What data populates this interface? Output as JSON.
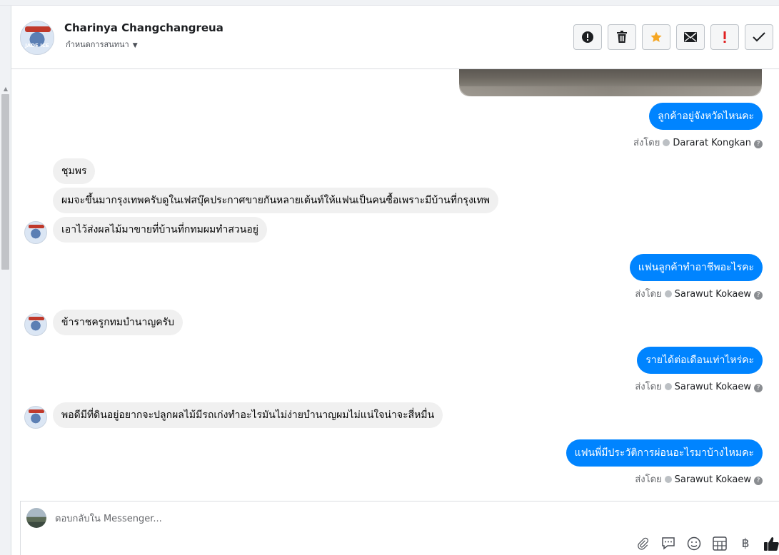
{
  "header": {
    "contact_name": "Charinya Changchangreua",
    "assign_label": "กำหนดการสนทนา",
    "avatar_text": "JADE ICE"
  },
  "toolbar": {
    "buttons": [
      {
        "name": "spam",
        "icon": "alert-circle-icon"
      },
      {
        "name": "delete",
        "icon": "trash-icon"
      },
      {
        "name": "star",
        "icon": "star-icon",
        "color": "#f5a623"
      },
      {
        "name": "mail",
        "icon": "envelope-icon"
      },
      {
        "name": "important",
        "icon": "exclamation-icon",
        "color": "#e02020"
      },
      {
        "name": "done",
        "icon": "check-icon"
      }
    ]
  },
  "messages": {
    "sent_by_prefix": "ส่งโดย",
    "items": [
      {
        "direction": "out",
        "text": "ลูกค้าอยู่จังหวัดไหนคะ",
        "agent": "Dararat Kongkan"
      },
      {
        "direction": "in",
        "text": "ชุมพร"
      },
      {
        "direction": "in",
        "text": "ผมจะขึ้นมากรุงเทพครับดูในเฟสบุ๊คประกาศขายกันหลายเต้นท์ให้แฟนเป็นคนซื้อเพราะมีบ้านที่กรุงเทพ"
      },
      {
        "direction": "in",
        "text": "เอาไว้ส่งผลไม้มาขายที่บ้านที่กทมผมทำสวนอยู่"
      },
      {
        "direction": "out",
        "text": "แฟนลูกค้าทำอาชีพอะไรคะ",
        "agent": "Sarawut Kokaew"
      },
      {
        "direction": "in",
        "text": "ข้าราชครูกทมบำนาญครับ"
      },
      {
        "direction": "out",
        "text": "รายได้ต่อเดือนเท่าไหร่คะ",
        "agent": "Sarawut Kokaew"
      },
      {
        "direction": "in",
        "text": "พอดีมีที่ดินอยู่อยากจะปลูกผลไม้มีรถเก่งทำอะไรมันไม่ง่ายบำนาญผมไม่แน่ใจน่าจะสี่หมื่น"
      },
      {
        "direction": "out",
        "text": "แฟนพี่มีประวัติการผ่อนอะไรมาบ้างไหมคะ",
        "agent": "Sarawut Kokaew"
      }
    ]
  },
  "composer": {
    "placeholder": "ตอบกลับใน Messenger...",
    "icons": [
      "paperclip-icon",
      "chat-bubble-icon",
      "emoji-icon",
      "table-icon",
      "baht-icon",
      "thumbs-up-icon"
    ],
    "baht_symbol": "฿"
  },
  "colors": {
    "outgoing_bubble": "#0084ff",
    "incoming_bubble": "#f0f0f0"
  }
}
